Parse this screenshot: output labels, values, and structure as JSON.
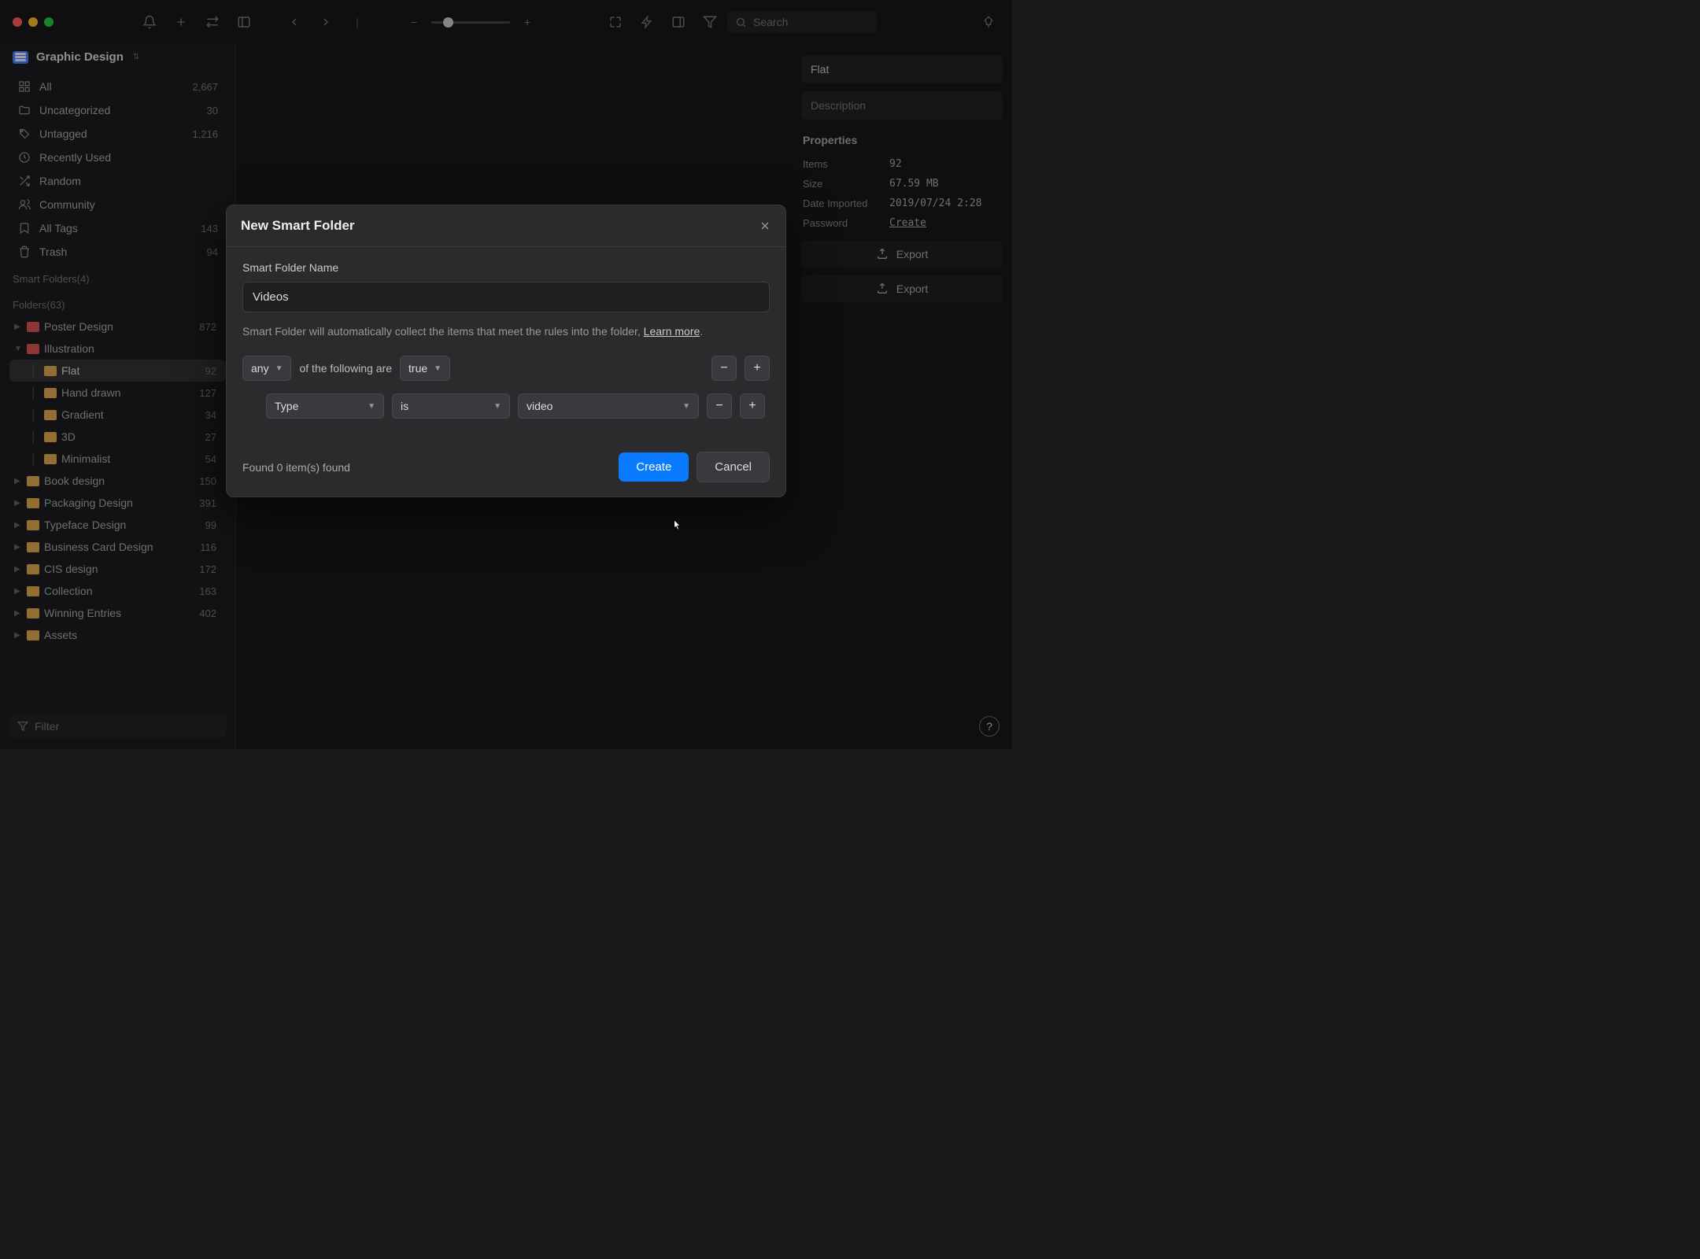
{
  "library": {
    "name": "Graphic Design"
  },
  "toolbar": {
    "search_placeholder": "Search"
  },
  "sidebar": {
    "items": [
      {
        "icon": "grid",
        "label": "All",
        "count": "2,667"
      },
      {
        "icon": "folder",
        "label": "Uncategorized",
        "count": "30"
      },
      {
        "icon": "tag",
        "label": "Untagged",
        "count": "1,216"
      },
      {
        "icon": "clock",
        "label": "Recently Used",
        "count": ""
      },
      {
        "icon": "shuffle",
        "label": "Random",
        "count": ""
      },
      {
        "icon": "people",
        "label": "Community",
        "count": ""
      },
      {
        "icon": "bookmark",
        "label": "All Tags",
        "count": "143"
      },
      {
        "icon": "trash",
        "label": "Trash",
        "count": "94"
      }
    ],
    "smart_folders_label": "Smart Folders(4)",
    "folders_label": "Folders(63)",
    "folders": [
      {
        "label": "Poster Design",
        "count": "872",
        "color": "#d9534f",
        "children": []
      },
      {
        "label": "Illustration",
        "count": "",
        "color": "#d9534f",
        "expanded": true,
        "children": [
          {
            "label": "Flat",
            "count": "92",
            "color": "#e0a94f",
            "selected": true
          },
          {
            "label": "Hand drawn",
            "count": "127",
            "color": "#e0a94f"
          },
          {
            "label": "Gradient",
            "count": "34",
            "color": "#e0a94f"
          },
          {
            "label": "3D",
            "count": "27",
            "color": "#e0a94f"
          },
          {
            "label": "Minimalist",
            "count": "54",
            "color": "#e0a94f"
          }
        ]
      },
      {
        "label": "Book design",
        "count": "150",
        "color": "#e0a94f",
        "children": []
      },
      {
        "label": "Packaging Design",
        "count": "391",
        "color": "#e0a94f",
        "children": []
      },
      {
        "label": "Typeface Design",
        "count": "99",
        "color": "#e0a94f",
        "children": []
      },
      {
        "label": "Business Card Design",
        "count": "116",
        "color": "#e0a94f",
        "children": []
      },
      {
        "label": "CIS design",
        "count": "172",
        "color": "#e0a94f",
        "children": []
      },
      {
        "label": "Collection",
        "count": "163",
        "color": "#e0a94f",
        "children": []
      },
      {
        "label": "Winning Entries",
        "count": "402",
        "color": "#e0a94f",
        "children": []
      },
      {
        "label": "Assets",
        "count": "",
        "color": "#e0a94f",
        "children": []
      }
    ],
    "filter_placeholder": "Filter"
  },
  "inspector": {
    "title_value": "Flat",
    "desc_placeholder": "Description",
    "properties_label": "Properties",
    "props": [
      {
        "k": "Items",
        "v": "92"
      },
      {
        "k": "Size",
        "v": "67.59 MB"
      },
      {
        "k": "Date Imported",
        "v": "2019/07/24 2:28"
      },
      {
        "k": "Password",
        "v": "Create",
        "link": true
      }
    ],
    "export_label": "Export"
  },
  "modal": {
    "title": "New Smart Folder",
    "name_label": "Smart Folder Name",
    "name_value": "Videos",
    "help_text": "Smart Folder will automatically collect the items that meet the rules into the folder, ",
    "learn_more": "Learn more",
    "match_selector": "any",
    "match_text": "of the following are",
    "match_value": "true",
    "rule": {
      "field": "Type",
      "op": "is",
      "value": "video"
    },
    "found_text": "Found 0 item(s) found",
    "create": "Create",
    "cancel": "Cancel"
  }
}
